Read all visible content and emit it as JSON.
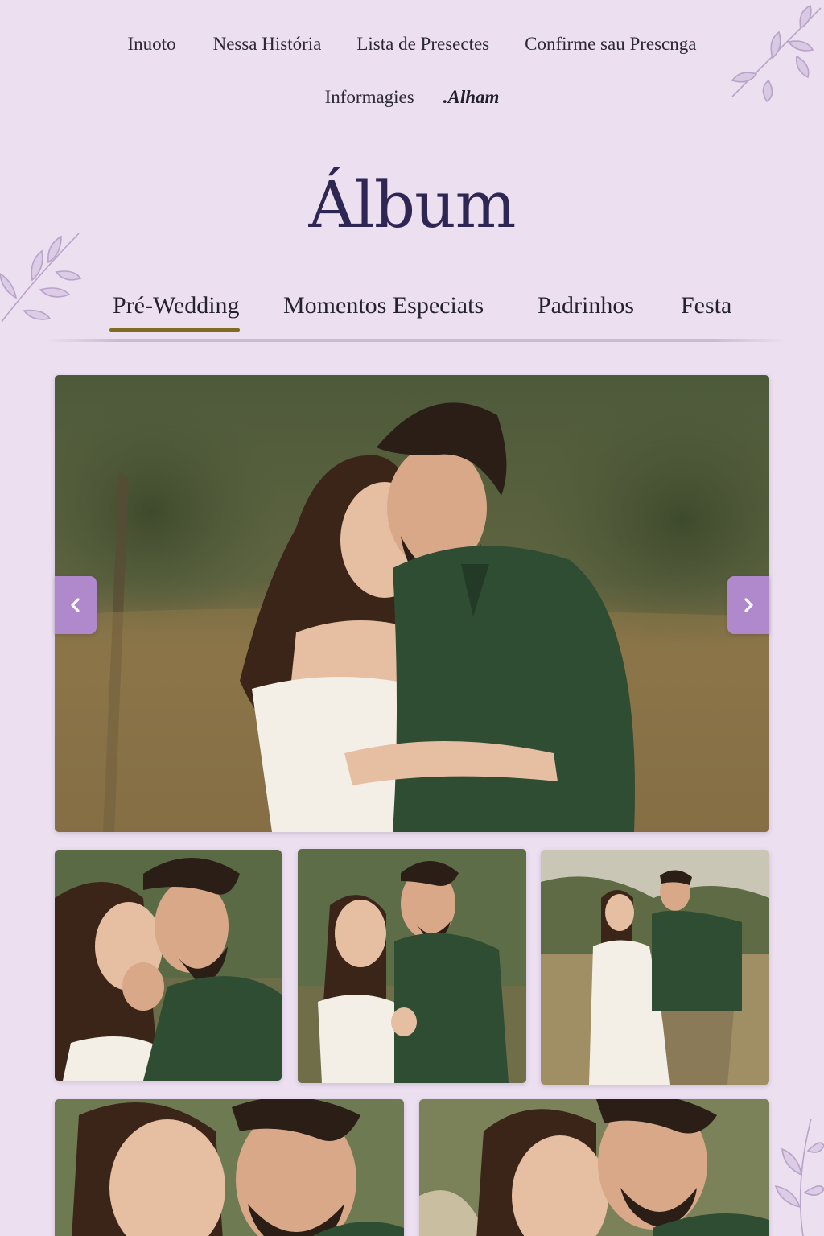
{
  "nav": {
    "items": [
      {
        "label": "Inuoto"
      },
      {
        "label": "Nessa História"
      },
      {
        "label": "Lista de Presectes"
      },
      {
        "label": "Confirme sau Prescnga"
      },
      {
        "label": "Informagies"
      },
      {
        "label": ".Alham"
      }
    ]
  },
  "page": {
    "title": "Álbum"
  },
  "tabs": [
    {
      "label": "Pré-Wedding",
      "active": true
    },
    {
      "label": "Momentos Especiats",
      "active": false
    },
    {
      "label": "Padrinhos",
      "active": false
    },
    {
      "label": "Festa",
      "active": false
    }
  ],
  "carousel": {
    "prev_icon": "chevron-left-icon",
    "next_icon": "chevron-right-icon"
  },
  "gallery": {
    "photos": [
      {
        "subject": "couple embracing in a field"
      },
      {
        "subject": "couple kissing close-up"
      },
      {
        "subject": "couple holding hands smiling"
      },
      {
        "subject": "couple walking on a path"
      },
      {
        "subject": "couple faces close-up"
      },
      {
        "subject": "couple forehead to forehead"
      }
    ]
  },
  "colors": {
    "background": "#ebdff0",
    "title": "#2e2753",
    "accent_underline": "#7d6c1f",
    "arrow_button": "#b088cc",
    "shirt_green": "#2f4d33",
    "dress_white": "#f4efe6"
  }
}
